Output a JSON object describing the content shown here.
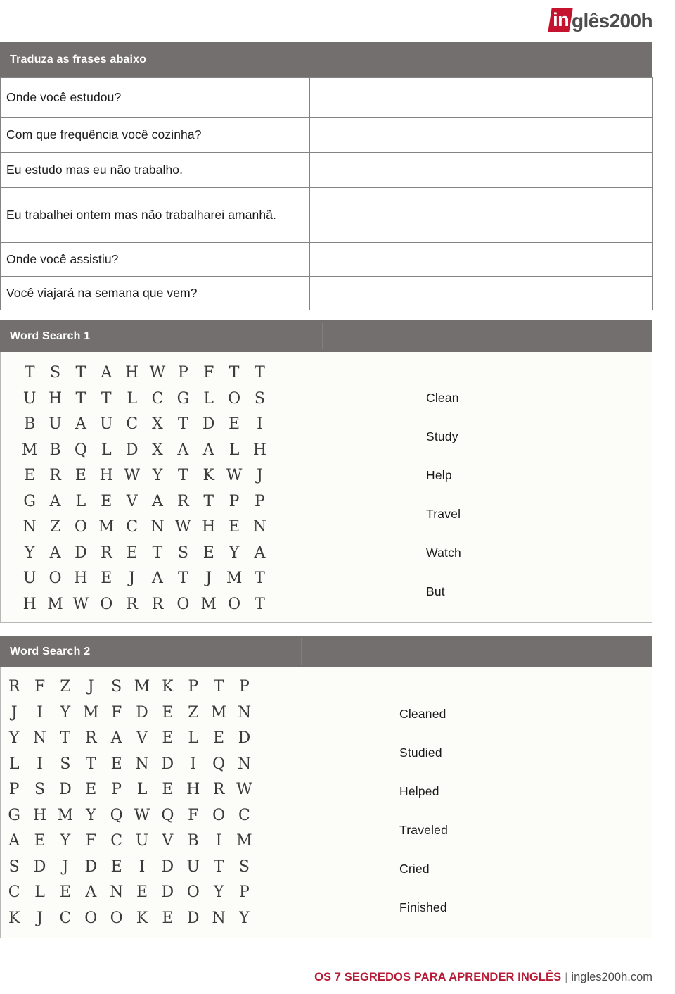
{
  "logo": {
    "badge_text": "in",
    "rest_text": "glês200h",
    "badge_color": "#c4122f",
    "rest_color": "#4d4d4d"
  },
  "translation_section": {
    "header": "Traduza as frases abaixo",
    "rows": [
      {
        "question": "Onde você estudou?",
        "answer": ""
      },
      {
        "question": "Com que frequência você cozinha?",
        "answer": ""
      },
      {
        "question": "Eu estudo mas eu não trabalho.",
        "answer": ""
      },
      {
        "question": "Eu trabalhei ontem mas não trabalharei amanhã.",
        "answer": ""
      },
      {
        "question": "Onde você assistiu?",
        "answer": ""
      },
      {
        "question": "Você viajará na semana que vem?",
        "answer": ""
      }
    ]
  },
  "word_search_1": {
    "header": "Word Search 1",
    "rows": 10,
    "cols": 11,
    "grid": [
      [
        "T",
        "S",
        "T",
        "A",
        "H",
        "W",
        "P",
        "F",
        "T",
        "T",
        ""
      ],
      [
        "U",
        "H",
        "T",
        "T",
        "L",
        "C",
        "G",
        "L",
        "O",
        "S",
        ""
      ],
      [
        "B",
        "U",
        "A",
        "U",
        "C",
        "X",
        "T",
        "D",
        "E",
        "I",
        ""
      ],
      [
        "M",
        "B",
        "Q",
        "L",
        "D",
        "X",
        "A",
        "A",
        "L",
        "H",
        ""
      ],
      [
        "E",
        "R",
        "E",
        "H",
        "W",
        "Y",
        "T",
        "K",
        "W",
        "J",
        ""
      ],
      [
        "G",
        "A",
        "L",
        "E",
        "V",
        "A",
        "R",
        "T",
        "P",
        "P",
        ""
      ],
      [
        "N",
        "Z",
        "O",
        "M",
        "C",
        "N",
        "W",
        "H",
        "E",
        "N",
        ""
      ],
      [
        "Y",
        "A",
        "D",
        "R",
        "E",
        "T",
        "S",
        "E",
        "Y",
        "A",
        ""
      ],
      [
        "U",
        "O",
        "H",
        "E",
        "J",
        "A",
        "T",
        "J",
        "M",
        "T",
        ""
      ],
      [
        "H",
        "M",
        "W",
        "O",
        "R",
        "R",
        "O",
        "M",
        "O",
        "T",
        ""
      ]
    ],
    "words": [
      "Clean",
      "Study",
      "Help",
      "Travel",
      "Watch",
      "But"
    ]
  },
  "word_search_2": {
    "header": "Word Search 2",
    "rows": 10,
    "cols": 11,
    "grid": [
      [
        "R",
        "F",
        "Z",
        "J",
        "S",
        "M",
        "K",
        "P",
        "T",
        "P",
        ""
      ],
      [
        "J",
        "I",
        "Y",
        "M",
        "F",
        "D",
        "E",
        "Z",
        "M",
        "N",
        ""
      ],
      [
        "Y",
        "N",
        "T",
        "R",
        "A",
        "V",
        "E",
        "L",
        "E",
        "D",
        ""
      ],
      [
        "L",
        "I",
        "S",
        "T",
        "E",
        "N",
        "D",
        "I",
        "Q",
        "N",
        ""
      ],
      [
        "P",
        "S",
        "D",
        "E",
        "P",
        "L",
        "E",
        "H",
        "R",
        "W",
        ""
      ],
      [
        "G",
        "H",
        "M",
        "Y",
        "Q",
        "W",
        "Q",
        "F",
        "O",
        "C",
        ""
      ],
      [
        "A",
        "E",
        "Y",
        "F",
        "C",
        "U",
        "V",
        "B",
        "I",
        "M",
        ""
      ],
      [
        "S",
        "D",
        "J",
        "D",
        "E",
        "I",
        "D",
        "U",
        "T",
        "S",
        ""
      ],
      [
        "C",
        "L",
        "E",
        "A",
        "N",
        "E",
        "D",
        "O",
        "Y",
        "P",
        ""
      ],
      [
        "K",
        "J",
        "C",
        "O",
        "O",
        "K",
        "E",
        "D",
        "N",
        "Y",
        ""
      ]
    ],
    "words": [
      "Cleaned",
      "Studied",
      "Helped",
      "Traveled",
      "Cried",
      "Finished"
    ]
  },
  "footer": {
    "main": "OS 7 SEGREDOS PARA APRENDER INGLÊS",
    "separator": "|",
    "site": "ingles200h.com",
    "main_color": "#b81b36"
  }
}
